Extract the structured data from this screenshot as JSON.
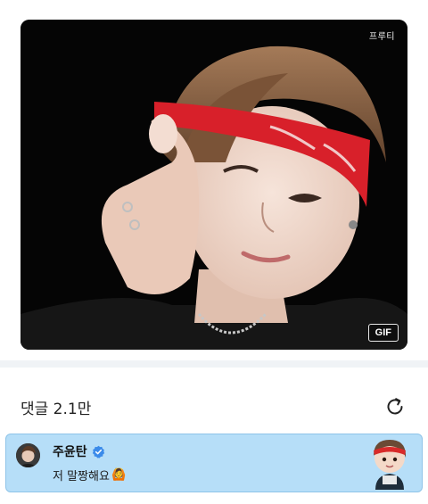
{
  "media": {
    "watermark": "프루티",
    "badge": "GIF"
  },
  "comments": {
    "title": "댓글 2.1만"
  },
  "comment": {
    "author": "주윤탄",
    "text": "저 말짱해요",
    "emoji": "🙆"
  },
  "icons": {
    "verified": "verified-check-icon",
    "refresh": "refresh-icon",
    "avatar": "profile-avatar",
    "sticker": "character-sticker"
  },
  "colors": {
    "card_bg": "#b6def8",
    "verified": "#3b8bea",
    "headband": "#d8202a"
  }
}
